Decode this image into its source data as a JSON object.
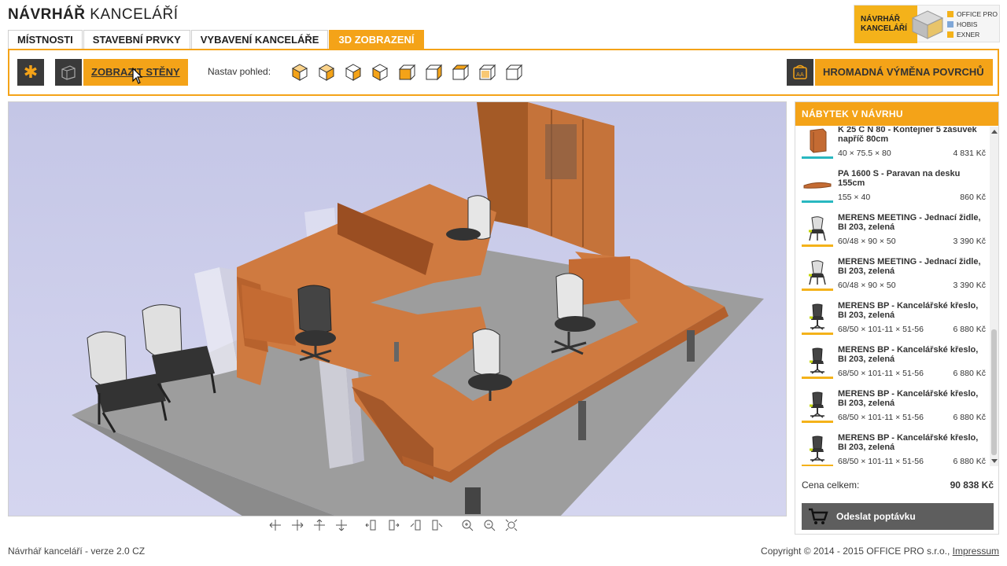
{
  "app": {
    "title_bold": "NÁVRHÁŘ",
    "title_light": "KANCELÁŘÍ"
  },
  "logo": {
    "text_line1": "NÁVRHÁŘ",
    "text_line2": "KANCELÁŘÍ",
    "brands": [
      "OFFICE PRO",
      "HOBIS",
      "EXNER"
    ]
  },
  "tabs": [
    {
      "label": "MÍSTNOSTI",
      "active": false
    },
    {
      "label": "STAVEBNÍ PRVKY",
      "active": false
    },
    {
      "label": "VYBAVENÍ KANCELÁŘE",
      "active": false
    },
    {
      "label": "3D ZOBRAZENÍ",
      "active": true
    }
  ],
  "toolbar": {
    "show_walls_label": "ZOBRAZIT STĚNY",
    "view_label": "Nastav pohled:",
    "bulk_replace_label": "HROMADNÁ VÝMĚNA POVRCHŮ",
    "view_icons": [
      "view-iso-1-icon",
      "view-iso-2-icon",
      "view-iso-3-icon",
      "view-iso-4-icon",
      "view-front-icon",
      "view-side-icon",
      "view-top-icon",
      "view-back-icon",
      "view-other-icon"
    ]
  },
  "panel": {
    "title": "NÁBYTEK V NÁVRHU",
    "items": [
      {
        "name": "K 25 C N 80 - Kontejner 5 zásuvek napříč 80cm",
        "dims": "40 × 75.5 × 80",
        "price": "4 831 Kč",
        "thumb": "container",
        "bar": "#29b8c0"
      },
      {
        "name": "PA 1600 S - Paravan na desku 155cm",
        "dims": "155 × 40",
        "price": "860 Kč",
        "thumb": "panel",
        "bar": "#29b8c0"
      },
      {
        "name": "MERENS MEETING - Jednací židle, BI 203, zelená",
        "dims": "60/48 × 90 × 50",
        "price": "3 390 Kč",
        "thumb": "chair-meeting",
        "bar": "#f4b21a"
      },
      {
        "name": "MERENS MEETING - Jednací židle, BI 203, zelená",
        "dims": "60/48 × 90 × 50",
        "price": "3 390 Kč",
        "thumb": "chair-meeting",
        "bar": "#f4b21a"
      },
      {
        "name": "MERENS BP - Kancelářské křeslo, BI 203, zelená",
        "dims": "68/50 × 101-11 × 51-56",
        "price": "6 880 Kč",
        "thumb": "chair-office",
        "bar": "#f4b21a"
      },
      {
        "name": "MERENS BP - Kancelářské křeslo, BI 203, zelená",
        "dims": "68/50 × 101-11 × 51-56",
        "price": "6 880 Kč",
        "thumb": "chair-office",
        "bar": "#f4b21a"
      },
      {
        "name": "MERENS BP - Kancelářské křeslo, BI 203, zelená",
        "dims": "68/50 × 101-11 × 51-56",
        "price": "6 880 Kč",
        "thumb": "chair-office",
        "bar": "#f4b21a"
      },
      {
        "name": "MERENS BP - Kancelářské křeslo, BI 203, zelená",
        "dims": "68/50 × 101-11 × 51-56",
        "price": "6 880 Kč",
        "thumb": "chair-office",
        "bar": "#f4b21a"
      }
    ],
    "total_label": "Cena celkem:",
    "total_value": "90 838 Kč",
    "send_label": "Odeslat poptávku"
  },
  "footer": {
    "version": "Návrhář kanceláří - verze 2.0 CZ",
    "copyright": "Copyright © 2014 - 2015 OFFICE PRO s.r.o.,",
    "impressum": "Impressum"
  },
  "colors": {
    "accent": "#f4a318",
    "dark": "#3a3a3a",
    "wood": "#c8733c",
    "floor": "#9a9a9a",
    "sky": "#c8cae8"
  }
}
